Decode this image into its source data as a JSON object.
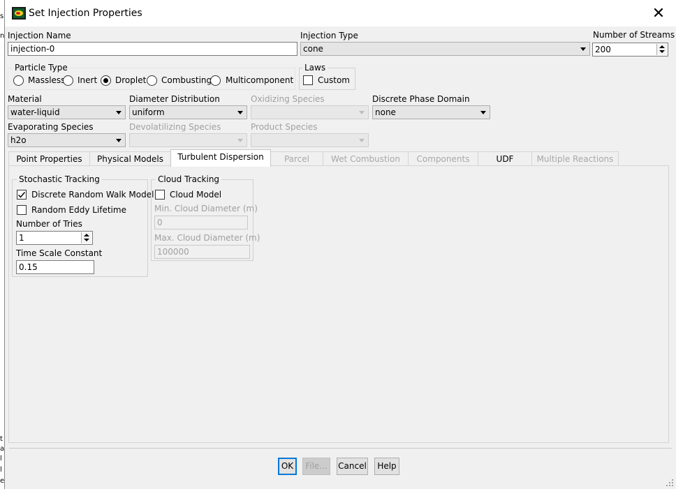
{
  "window": {
    "title": "Set Injection Properties"
  },
  "background": {
    "glyphs": [
      "s",
      "n",
      "t",
      "a",
      "l",
      "l",
      "e"
    ]
  },
  "injection_name": {
    "label": "Injection Name",
    "value": "injection-0"
  },
  "injection_type": {
    "label": "Injection Type",
    "value": "cone"
  },
  "num_streams": {
    "label": "Number of Streams",
    "value": "200"
  },
  "particle_type": {
    "label": "Particle Type",
    "options": [
      "Massless",
      "Inert",
      "Droplet",
      "Combusting",
      "Multicomponent"
    ],
    "selected": "Droplet"
  },
  "laws": {
    "label": "Laws",
    "custom_label": "Custom"
  },
  "material": {
    "label": "Material",
    "value": "water-liquid"
  },
  "diameter_distribution": {
    "label": "Diameter Distribution",
    "value": "uniform"
  },
  "oxidizing_species": {
    "label": "Oxidizing Species",
    "value": ""
  },
  "discrete_phase_domain": {
    "label": "Discrete Phase Domain",
    "value": "none"
  },
  "evaporating_species": {
    "label": "Evaporating Species",
    "value": "h2o"
  },
  "devolatilizing_species": {
    "label": "Devolatilizing Species",
    "value": ""
  },
  "product_species": {
    "label": "Product Species",
    "value": ""
  },
  "tabs": [
    {
      "label": "Point Properties"
    },
    {
      "label": "Physical Models"
    },
    {
      "label": "Turbulent Dispersion"
    },
    {
      "label": "Parcel"
    },
    {
      "label": "Wet Combustion"
    },
    {
      "label": "Components"
    },
    {
      "label": "UDF"
    },
    {
      "label": "Multiple Reactions"
    }
  ],
  "stochastic": {
    "title": "Stochastic Tracking",
    "drw_label": "Discrete Random Walk Model",
    "drw_checked": true,
    "rel_label": "Random Eddy Lifetime",
    "rel_checked": false,
    "tries_label": "Number of Tries",
    "tries_value": "1",
    "tsc_label": "Time Scale Constant",
    "tsc_value": "0.15"
  },
  "cloud": {
    "title": "Cloud Tracking",
    "model_label": "Cloud Model",
    "model_checked": false,
    "min_label": "Min. Cloud Diameter (m)",
    "min_value": "0",
    "max_label": "Max. Cloud Diameter (m)",
    "max_value": "100000"
  },
  "buttons": {
    "ok": "OK",
    "file": "File...",
    "cancel": "Cancel",
    "help": "Help"
  }
}
